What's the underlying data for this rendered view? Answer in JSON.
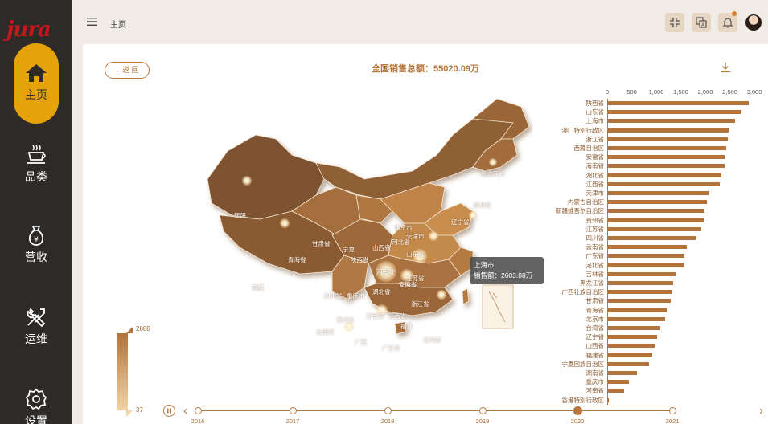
{
  "brand": {
    "logo_text": "jura"
  },
  "nav": [
    {
      "label": "主页",
      "icon": "home-icon",
      "active": true
    },
    {
      "label": "品类",
      "icon": "coffee-cup-icon",
      "active": false
    },
    {
      "label": "营收",
      "icon": "money-bag-icon",
      "active": false
    },
    {
      "label": "运维",
      "icon": "tools-icon",
      "active": false
    },
    {
      "label": "设置",
      "icon": "gear-icon",
      "active": false
    }
  ],
  "header": {
    "breadcrumb": "主页",
    "buttons": [
      "collapse-icon",
      "translate-icon",
      "bell-icon"
    ],
    "has_notification": true
  },
  "main": {
    "back_label": "←返 回",
    "title": "全国销售总额：55020.09万",
    "tooltip": {
      "line1": "上海市:",
      "line2": "销售额：2603.88万"
    },
    "legend": {
      "max": "2888",
      "min": "37"
    },
    "map_labels": [
      "新疆",
      "西藏",
      "青海省",
      "甘肃省",
      "宁夏",
      "陕西省",
      "山西省",
      "河南省",
      "北京市",
      "天津市",
      "河北省",
      "山东省",
      "江苏省",
      "安徽省",
      "湖北省",
      "四川省",
      "重庆市",
      "湖南省",
      "江西省",
      "浙江省",
      "贵州省",
      "云南省",
      "广西",
      "广东省",
      "福建",
      "台湾省",
      "黑龙江省",
      "吉林省",
      "辽宁省"
    ]
  },
  "chart_data": {
    "type": "bar",
    "orientation": "horizontal",
    "xlim": [
      0,
      3000
    ],
    "xticks": [
      "0",
      "500",
      "1,000",
      "1,500",
      "2,000",
      "2,500",
      "3,000"
    ],
    "categories": [
      "陕西省",
      "山东省",
      "上海市",
      "澳门特别行政区",
      "浙江省",
      "西藏自治区",
      "安徽省",
      "海南省",
      "湖北省",
      "江西省",
      "天津市",
      "内蒙古自治区",
      "新疆维吾尔自治区",
      "贵州省",
      "江苏省",
      "四川省",
      "云南省",
      "广东省",
      "河北省",
      "吉林省",
      "黑龙江省",
      "广西壮族自治区",
      "甘肃省",
      "青海省",
      "北京市",
      "台湾省",
      "辽宁省",
      "山西省",
      "福建省",
      "宁夏回族自治区",
      "湖南省",
      "重庆市",
      "河南省",
      "香港特别行政区"
    ],
    "values": [
      2880,
      2740,
      2604,
      2480,
      2460,
      2420,
      2400,
      2390,
      2330,
      2300,
      2080,
      2040,
      1990,
      1970,
      1920,
      1820,
      1620,
      1580,
      1560,
      1400,
      1340,
      1330,
      1290,
      1220,
      1180,
      1090,
      1010,
      960,
      920,
      860,
      610,
      450,
      350,
      37
    ]
  },
  "timeline": {
    "years": [
      "2016",
      "2017",
      "2018",
      "2019",
      "2020",
      "2021"
    ],
    "active_year": "2020"
  }
}
